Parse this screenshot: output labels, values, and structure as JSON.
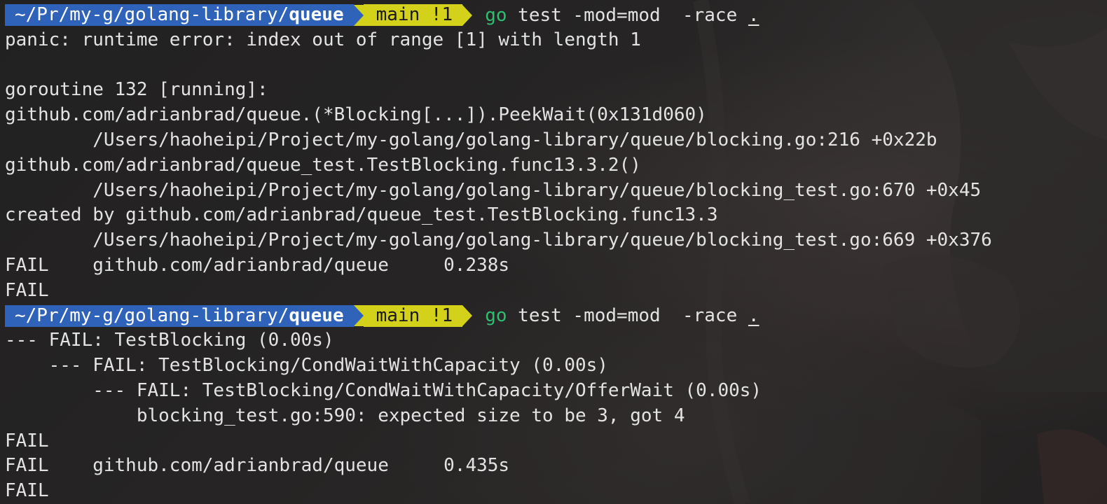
{
  "colors": {
    "dir_segment_bg": "#2f63b9",
    "git_segment_bg": "#d4d11a",
    "command_green": "#2fbf71",
    "text": "#e3e3e3"
  },
  "prompt_1": {
    "dir_prefix": "~/Pr/my-g/golang-library/",
    "dir_current": "queue",
    "git_branch": "main !1",
    "command_name": "go",
    "command_args": " test -mod=mod  -race ",
    "command_target": "."
  },
  "output_1": [
    "panic: runtime error: index out of range [1] with length 1",
    "",
    "goroutine 132 [running]:",
    "github.com/adrianbrad/queue.(*Blocking[...]).PeekWait(0x131d060)",
    "        /Users/haoheipi/Project/my-golang/golang-library/queue/blocking.go:216 +0x22b",
    "github.com/adrianbrad/queue_test.TestBlocking.func13.3.2()",
    "        /Users/haoheipi/Project/my-golang/golang-library/queue/blocking_test.go:670 +0x45",
    "created by github.com/adrianbrad/queue_test.TestBlocking.func13.3",
    "        /Users/haoheipi/Project/my-golang/golang-library/queue/blocking_test.go:669 +0x376",
    "FAIL    github.com/adrianbrad/queue     0.238s",
    "FAIL"
  ],
  "prompt_2": {
    "dir_prefix": "~/Pr/my-g/golang-library/",
    "dir_current": "queue",
    "git_branch": "main !1",
    "command_name": "go",
    "command_args": " test -mod=mod  -race ",
    "command_target": "."
  },
  "output_2": [
    "--- FAIL: TestBlocking (0.00s)",
    "    --- FAIL: TestBlocking/CondWaitWithCapacity (0.00s)",
    "        --- FAIL: TestBlocking/CondWaitWithCapacity/OfferWait (0.00s)",
    "            blocking_test.go:590: expected size to be 3, got 4",
    "FAIL",
    "FAIL    github.com/adrianbrad/queue     0.435s",
    "FAIL"
  ]
}
